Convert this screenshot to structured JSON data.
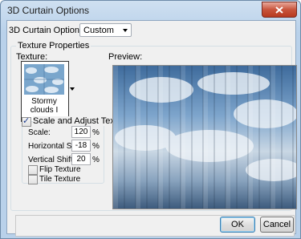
{
  "window": {
    "title": "3D Curtain Options"
  },
  "options_row": {
    "label": "3D Curtain Options",
    "selected": "Custom"
  },
  "texture_properties": {
    "legend": "Texture Properties",
    "texture_label": "Texture:",
    "preview_label": "Preview:",
    "texture_name": "Stormy clouds I"
  },
  "scale_adjust": {
    "label": "Scale and Adjust Texture",
    "checked": true,
    "scale": {
      "label": "Scale:",
      "value": "120",
      "unit": "%"
    },
    "horizontal_shift": {
      "label": "Horizontal Shift:",
      "value": "-18",
      "unit": "%"
    },
    "vertical_shift": {
      "label": "Vertical Shift:",
      "value": "20",
      "unit": "%"
    },
    "flip_texture": {
      "label": "Flip Texture",
      "checked": false
    },
    "tile_texture": {
      "label": "Tile Texture",
      "checked": false
    }
  },
  "buttons": {
    "ok": "OK",
    "cancel": "Cancel"
  },
  "icons": {
    "close": "close-icon",
    "dropdown": "chevron-down-icon",
    "check": "check-icon"
  }
}
